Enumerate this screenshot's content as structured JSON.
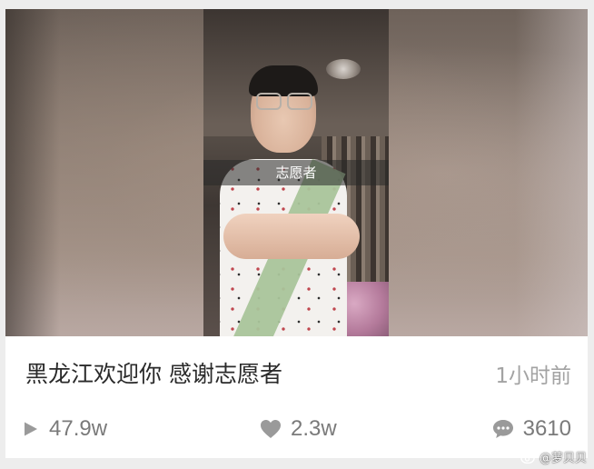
{
  "video": {
    "caption": "志愿者"
  },
  "post": {
    "title": "黑龙江欢迎你 感谢志愿者",
    "time": "1小时前"
  },
  "stats": {
    "views": "47.9w",
    "likes": "2.3w",
    "comments": "3610"
  },
  "icons": {
    "views": "play-icon",
    "likes": "heart-icon",
    "comments": "comment-bubble-icon",
    "watermark": "weibo-logo-icon"
  },
  "watermark": {
    "text": "@萝贝贝"
  },
  "colors": {
    "title": "#2a2a2a",
    "meta": "#a3a3a3",
    "stat": "#7a7a7a",
    "card_bg": "#ffffff",
    "page_bg": "#ededed"
  }
}
